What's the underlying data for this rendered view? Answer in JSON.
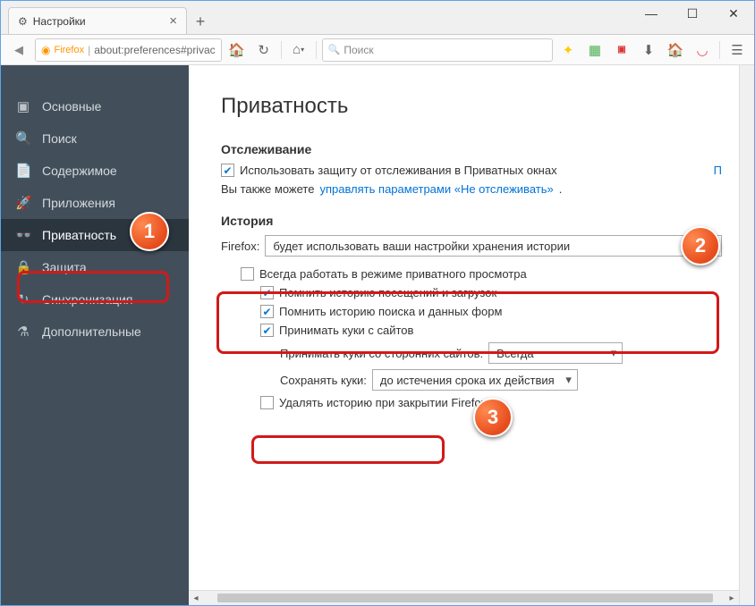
{
  "window": {
    "min": "—",
    "max": "☐",
    "close": "✕"
  },
  "tab": {
    "title": "Настройки"
  },
  "toolbar": {
    "firefox_label": "Firefox",
    "url": "about:preferences#privac",
    "search_placeholder": "Поиск"
  },
  "sidebar": {
    "items": [
      {
        "icon": "▣",
        "label": "Основные"
      },
      {
        "icon": "🔍",
        "label": "Поиск"
      },
      {
        "icon": "📄",
        "label": "Содержимое"
      },
      {
        "icon": "🚀",
        "label": "Приложения"
      },
      {
        "icon": "👓",
        "label": "Приватность"
      },
      {
        "icon": "🔒",
        "label": "Защита"
      },
      {
        "icon": "↻",
        "label": "Синхронизация"
      },
      {
        "icon": "⚗",
        "label": "Дополнительные"
      }
    ]
  },
  "main": {
    "title": "Приватность",
    "tracking": {
      "heading": "Отслеживание",
      "use_protection": "Использовать защиту от отслеживания в Приватных окнах",
      "learn_more": "П",
      "also_text": "Вы также можете ",
      "dnt_link": "управлять параметрами «Не отслеживать»",
      "dot": "."
    },
    "history": {
      "heading": "История",
      "firefox_label": "Firefox:",
      "mode": "будет использовать ваши настройки хранения истории",
      "always_private": "Всегда работать в режиме приватного просмотра",
      "remember_browsing": "Помнить историю посещений и загрузок",
      "remember_search": "Помнить историю поиска и данных форм",
      "accept_cookies": "Принимать куки с сайтов",
      "third_party_label": "Принимать куки со сторонних сайтов:",
      "third_party_value": "Всегда",
      "keep_label": "Сохранять куки:",
      "keep_value": "до истечения срока их действия",
      "clear_on_close": "Удалять историю при закрытии Firefox"
    }
  },
  "callouts": {
    "c1": "1",
    "c2": "2",
    "c3": "3"
  }
}
